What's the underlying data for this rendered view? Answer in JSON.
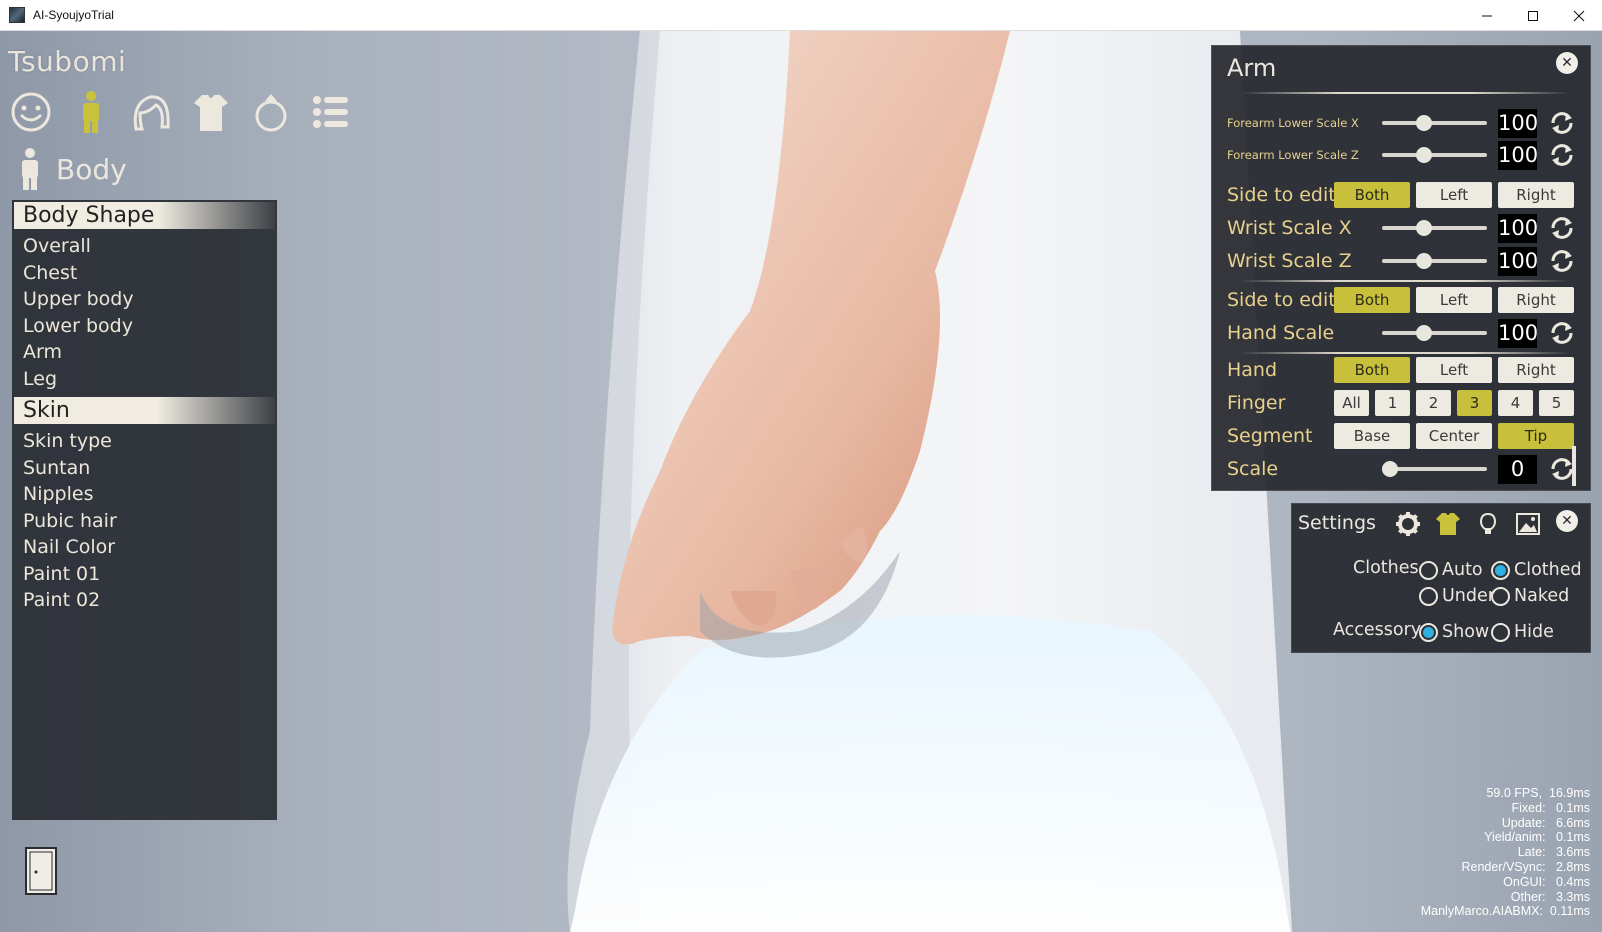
{
  "window": {
    "title": "AI-SyoujyoTrial",
    "buttons": {
      "minimize": "—",
      "maximize": "☐",
      "close": "✕"
    }
  },
  "left": {
    "character_name": "Tsubomi",
    "top_icons": [
      "face-icon",
      "body-icon",
      "hair-icon",
      "clothes-icon",
      "accessory-icon",
      "list-icon"
    ],
    "section_label": "Body",
    "groups": [
      {
        "header": "Body Shape",
        "items": [
          "Overall",
          "Chest",
          "Upper body",
          "Lower body",
          "Arm",
          "Leg"
        ]
      },
      {
        "header": "Skin",
        "items": [
          "Skin type",
          "Suntan",
          "Nipples",
          "Pubic hair",
          "Nail Color",
          "Paint 01",
          "Paint 02"
        ]
      }
    ]
  },
  "arm_panel": {
    "title": "Arm",
    "close": "✕",
    "forearm_x": {
      "label": "Forearm Lower Scale X",
      "value": "100",
      "slider": 0.38
    },
    "forearm_z": {
      "label": "Forearm Lower Scale Z",
      "value": "100",
      "slider": 0.38
    },
    "side1": {
      "label": "Side to edit",
      "options": [
        "Both",
        "Left",
        "Right"
      ],
      "selected": "Both"
    },
    "wrist_x": {
      "label": "Wrist Scale X",
      "value": "100",
      "slider": 0.38
    },
    "wrist_z": {
      "label": "Wrist Scale Z",
      "value": "100",
      "slider": 0.38
    },
    "side2": {
      "label": "Side to edit",
      "options": [
        "Both",
        "Left",
        "Right"
      ],
      "selected": "Both"
    },
    "hand_scale": {
      "label": "Hand Scale",
      "value": "100",
      "slider": 0.38
    },
    "hand": {
      "label": "Hand",
      "options": [
        "Both",
        "Left",
        "Right"
      ],
      "selected": "Both"
    },
    "finger": {
      "label": "Finger",
      "options": [
        "All",
        "1",
        "2",
        "3",
        "4",
        "5"
      ],
      "selected": "3"
    },
    "segment": {
      "label": "Segment",
      "options": [
        "Base",
        "Center",
        "Tip"
      ],
      "selected": "Tip"
    },
    "scale": {
      "label": "Scale",
      "value": "0",
      "slider": 0.0
    }
  },
  "settings": {
    "title": "Settings",
    "close": "✕",
    "icons": [
      "gear-icon",
      "clothes-icon",
      "light-icon",
      "background-icon"
    ],
    "clothes_label": "Clothes",
    "clothes_options": [
      "Auto",
      "Clothed",
      "Under",
      "Naked"
    ],
    "clothes_selected": "Clothed",
    "accessory_label": "Accessory",
    "accessory_options": [
      "Show",
      "Hide"
    ],
    "accessory_selected": "Show"
  },
  "stats": [
    "59.0 FPS,  16.9ms",
    "Fixed:   0.1ms",
    "Update:   6.6ms",
    "Yield/anim:   0.1ms",
    "Late:   3.6ms",
    "Render/VSync:   2.8ms",
    "OnGUI:   0.4ms",
    "Other:   3.3ms",
    "ManlyMarco.AIABMX:  0.11ms"
  ],
  "colors": {
    "accent": "#c8c03a",
    "label_gold": "#e7d18c",
    "radio_selected": "#2fb0e0",
    "panel_bg": "#26282e"
  }
}
